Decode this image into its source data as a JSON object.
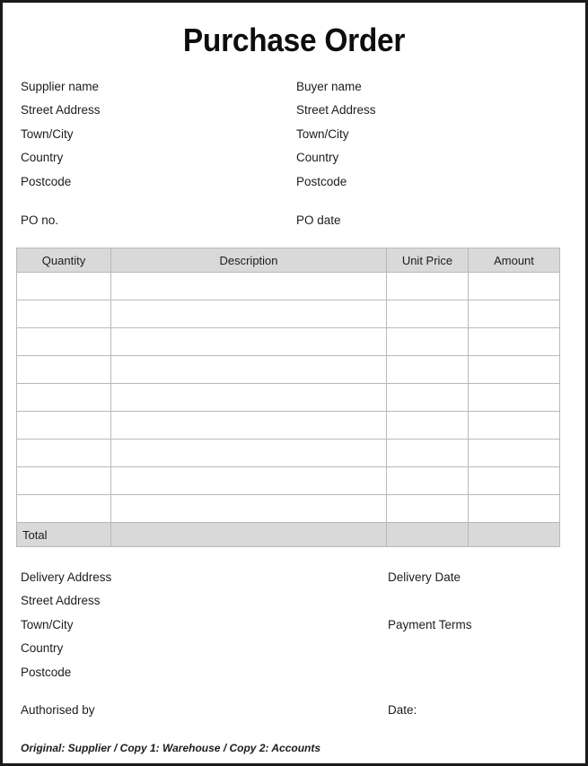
{
  "document": {
    "title": "Purchase Order"
  },
  "parties": {
    "rows": [
      {
        "left": "Supplier name",
        "right": "Buyer name"
      },
      {
        "left": "Street Address",
        "right": "Street Address"
      },
      {
        "left": "Town/City",
        "right": "Town/City"
      },
      {
        "left": "Country",
        "right": "Country"
      },
      {
        "left": "Postcode",
        "right": "Postcode"
      }
    ],
    "po_number_label": "PO no.",
    "po_date_label": "PO date"
  },
  "items_table": {
    "headers": [
      "Quantity",
      "Description",
      "Unit Price",
      "Amount"
    ],
    "rows": [
      {
        "quantity": "",
        "description": "",
        "unit_price": "",
        "amount": ""
      },
      {
        "quantity": "",
        "description": "",
        "unit_price": "",
        "amount": ""
      },
      {
        "quantity": "",
        "description": "",
        "unit_price": "",
        "amount": ""
      },
      {
        "quantity": "",
        "description": "",
        "unit_price": "",
        "amount": ""
      },
      {
        "quantity": "",
        "description": "",
        "unit_price": "",
        "amount": ""
      },
      {
        "quantity": "",
        "description": "",
        "unit_price": "",
        "amount": ""
      },
      {
        "quantity": "",
        "description": "",
        "unit_price": "",
        "amount": ""
      },
      {
        "quantity": "",
        "description": "",
        "unit_price": "",
        "amount": ""
      },
      {
        "quantity": "",
        "description": "",
        "unit_price": "",
        "amount": ""
      }
    ],
    "row_count": 9,
    "total_label": "Total",
    "total_value": "",
    "header_fill": "#d9d9d9",
    "total_fill": "#d9d9d9",
    "grid_color": "#b9b9b9"
  },
  "delivery": {
    "rows": [
      {
        "left": "Delivery Address",
        "right": "Delivery Date"
      },
      {
        "left": "Street Address",
        "right": ""
      },
      {
        "left": "Town/City",
        "right": "Payment Terms"
      },
      {
        "left": "Country",
        "right": ""
      },
      {
        "left": "Postcode",
        "right": ""
      }
    ],
    "authorised_by_label": "Authorised by",
    "date_label": "Date:"
  },
  "footer": {
    "note": "Original: Supplier / Copy 1: Warehouse / Copy 2: Accounts"
  },
  "theme": {
    "page_background": "#ffffff",
    "border_color": "#1a1a1a",
    "text_color": "#1c1c1c"
  }
}
